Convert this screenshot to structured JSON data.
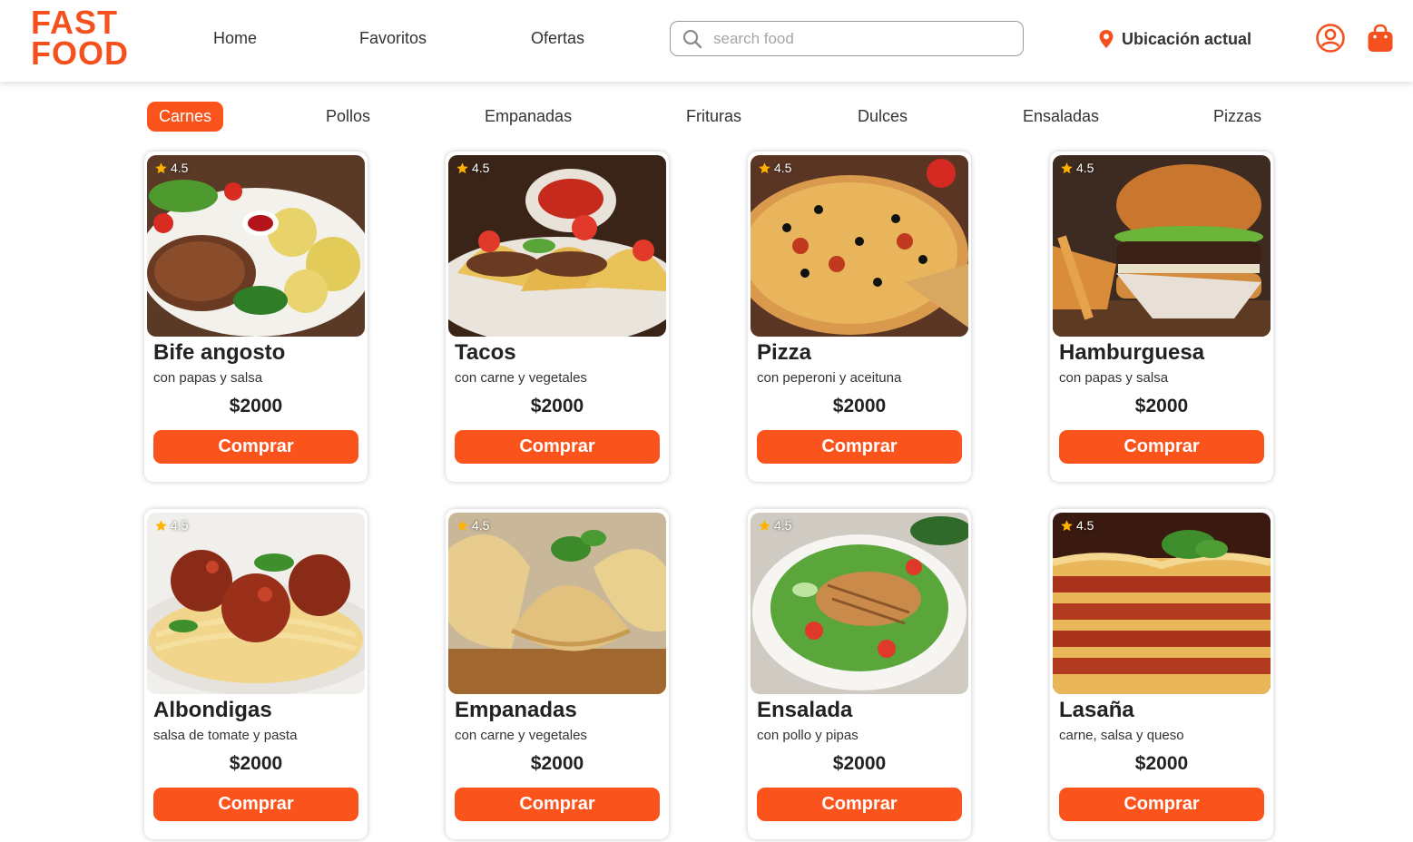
{
  "brand": {
    "line1": "FAST",
    "line2": "FOOD",
    "color": "#f4511e",
    "icon": "pizza-slice-icon"
  },
  "nav": [
    {
      "label": "Home"
    },
    {
      "label": "Favoritos"
    },
    {
      "label": "Ofertas"
    }
  ],
  "search": {
    "placeholder": "search food",
    "value": "",
    "icon": "search-icon"
  },
  "location": {
    "label": "Ubicación actual",
    "icon": "map-pin-icon"
  },
  "header_icons": {
    "user": "user-circle-icon",
    "cart": "shopping-bag-icon"
  },
  "categories": [
    {
      "label": "Carnes",
      "active": true
    },
    {
      "label": "Pollos",
      "active": false
    },
    {
      "label": "Empanadas",
      "active": false
    },
    {
      "label": "Frituras",
      "active": false
    },
    {
      "label": "Dulces",
      "active": false
    },
    {
      "label": "Ensaladas",
      "active": false
    },
    {
      "label": "Pizzas",
      "active": false
    }
  ],
  "products": [
    {
      "title": "Bife angosto",
      "desc": "con papas y salsa",
      "price": "$2000",
      "rating": "4.5",
      "button": "Comprar",
      "image": "steak-with-potatoes"
    },
    {
      "title": "Tacos",
      "desc": "con carne y vegetales",
      "price": "$2000",
      "rating": "4.5",
      "button": "Comprar",
      "image": "tacos"
    },
    {
      "title": "Pizza",
      "desc": "con peperoni y aceituna",
      "price": "$2000",
      "rating": "4.5",
      "button": "Comprar",
      "image": "pizza"
    },
    {
      "title": "Hamburguesa",
      "desc": "con papas y salsa",
      "price": "$2000",
      "rating": "4.5",
      "button": "Comprar",
      "image": "burger"
    },
    {
      "title": "Albondigas",
      "desc": "salsa de tomate y pasta",
      "price": "$2000",
      "rating": "4.5",
      "button": "Comprar",
      "image": "meatballs-pasta"
    },
    {
      "title": "Empanadas",
      "desc": "con carne y vegetales",
      "price": "$2000",
      "rating": "4.5",
      "button": "Comprar",
      "image": "empanadas"
    },
    {
      "title": "Ensalada",
      "desc": "con pollo y pipas",
      "price": "$2000",
      "rating": "4.5",
      "button": "Comprar",
      "image": "chicken-salad"
    },
    {
      "title": "Lasaña",
      "desc": "carne, salsa y queso",
      "price": "$2000",
      "rating": "4.5",
      "button": "Comprar",
      "image": "lasagna"
    }
  ],
  "colors": {
    "accent": "#fa541c",
    "star": "#ffb300",
    "text": "#222222"
  }
}
